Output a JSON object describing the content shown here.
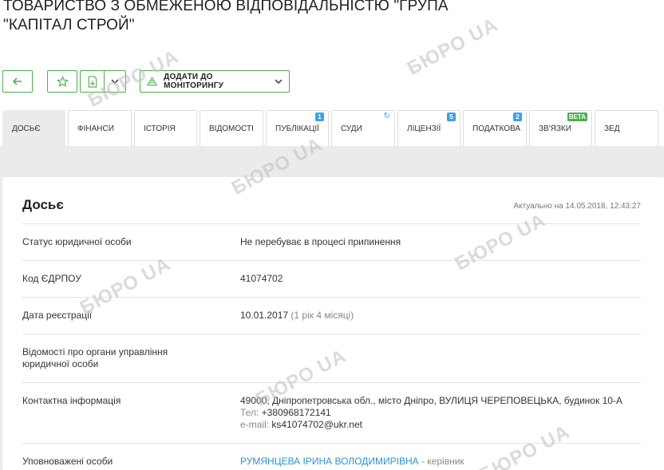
{
  "company": {
    "title": "ТОВАРИСТВО З ОБМЕЖЕНОЮ ВІДПОВІДАЛЬНІСТЮ \"ГРУПА \"КАПІТАЛ СТРОЙ\""
  },
  "toolbar": {
    "monitor_label": "ДОДАТИ ДО МОНІТОРИНГУ",
    "icons": [
      "arrow-left-icon",
      "star-icon",
      "export-doc-icon",
      "chevron-down-icon",
      "monitor-icon",
      "chevron-down-icon"
    ]
  },
  "tabs": [
    {
      "label": "ДОСЬЄ",
      "active": true
    },
    {
      "label": "ФІНАНСИ"
    },
    {
      "label": "ІСТОРІЯ"
    },
    {
      "label": "ВІДОМОСТІ"
    },
    {
      "label": "ПУБЛІКАЦІЇ",
      "badge": "1"
    },
    {
      "label": "СУДИ",
      "icon": "sync-icon"
    },
    {
      "label": "ЛІЦЕНЗІЇ",
      "badge": "5"
    },
    {
      "label": "ПОДАТКОВА",
      "badge": "2"
    },
    {
      "label": "ЗВ'ЯЗКИ",
      "badge": "beta"
    },
    {
      "label": "ЗЕД"
    }
  ],
  "dossier": {
    "title": "Досьє",
    "updated": "Актуально на 14.05.2018, 12:43:27",
    "rows": [
      {
        "label": "Статус юридичної особи",
        "value": "Не перебуває в процесі припинення"
      },
      {
        "label": "Код ЄДРПОУ",
        "value": "41074702"
      },
      {
        "label": "Дата реєстрації",
        "value": "10.01.2017",
        "note": "(1 рік 4 місяці)"
      },
      {
        "label": "Відомості про органи управління юридичної особи",
        "value": ""
      },
      {
        "label": "Контактна інформація",
        "address": "49000, Дніпропетровська обл., місто Дніпро, ВУЛИЦЯ ЧЕРЕПОВЕЦЬКА, будинок 10-А",
        "phone_label": "Тел:",
        "phone": "+380968172141",
        "email_label": "e-mail:",
        "email": "ks41074702@ukr.net"
      },
      {
        "label": "Уповноважені особи",
        "person": "РУМЯНЦЕВА ІРИНА ВОЛОДИМИРІВНА",
        "role": "- керівник"
      }
    ]
  },
  "watermark": "БЮРО UA",
  "colors": {
    "accent": "#4caf50",
    "badge": "#3ea0e8",
    "link": "#2d8fd5"
  }
}
